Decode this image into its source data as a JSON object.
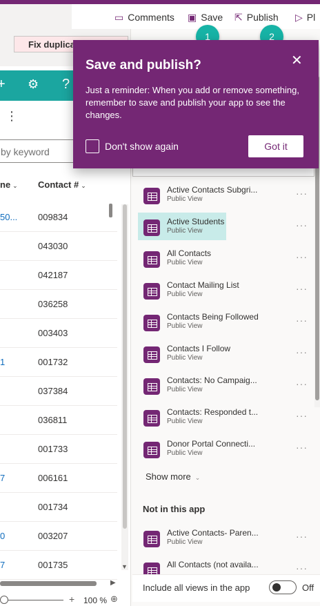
{
  "toolbar": {
    "comments_label": "Comments",
    "save_label": "Save",
    "publish_label": "Publish",
    "next_label": "Pl",
    "steps": [
      "1",
      "2"
    ]
  },
  "left": {
    "fix_label": "Fix duplica",
    "search_placeholder": "by keyword",
    "columns": [
      "ne",
      "Contact #"
    ],
    "rows": [
      {
        "name": "50...",
        "contact": "009834"
      },
      {
        "name": "",
        "contact": "043030"
      },
      {
        "name": "",
        "contact": "042187"
      },
      {
        "name": "",
        "contact": "036258"
      },
      {
        "name": "",
        "contact": "003403"
      },
      {
        "name": "1",
        "contact": "001732"
      },
      {
        "name": "",
        "contact": "037384"
      },
      {
        "name": "",
        "contact": "036811"
      },
      {
        "name": "",
        "contact": "001733"
      },
      {
        "name": "7",
        "contact": "006161"
      },
      {
        "name": "",
        "contact": "001734"
      },
      {
        "name": "0",
        "contact": "003207"
      },
      {
        "name": "7",
        "contact": "001735"
      }
    ],
    "zoom": "100 %"
  },
  "callout": {
    "title": "Save and publish?",
    "body": "Just a reminder: When you add or remove something, remember to save and publish your app to see the changes.",
    "checkbox_label": "Don't show again",
    "button_label": "Got it"
  },
  "views": [
    {
      "name": "Active Contacts Subgri...",
      "type": "Public View"
    },
    {
      "name": "Active Students",
      "type": "Public View"
    },
    {
      "name": "All Contacts",
      "type": "Public View"
    },
    {
      "name": "Contact Mailing List",
      "type": "Public View"
    },
    {
      "name": "Contacts Being Followed",
      "type": "Public View"
    },
    {
      "name": "Contacts I Follow",
      "type": "Public View"
    },
    {
      "name": "Contacts: No Campaig...",
      "type": "Public View"
    },
    {
      "name": "Contacts: Responded t...",
      "type": "Public View"
    },
    {
      "name": "Donor Portal Connecti...",
      "type": "Public View"
    }
  ],
  "show_more": "Show more",
  "not_in_app": {
    "title": "Not in this app",
    "views": [
      {
        "name": "Active Contacts- Paren...",
        "type": "Public View"
      },
      {
        "name": "All Contacts (not availa...",
        "type": ""
      }
    ]
  },
  "footer": {
    "label": "Include all views in the app",
    "toggle_state": "Off"
  },
  "colors": {
    "brand": "#742774",
    "teal": "#1ba6a0",
    "step_badge": "#17b3a6",
    "selection": "#c8ebe9"
  }
}
